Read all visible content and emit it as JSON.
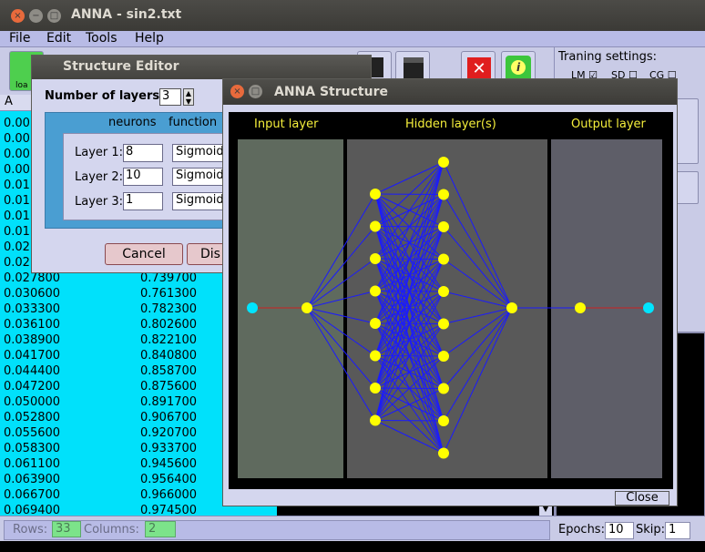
{
  "main": {
    "title": "ANNA - sin2.txt",
    "menu": [
      "File",
      "Edit",
      "Tools",
      "Help"
    ],
    "toolbar": {
      "load_label": "loa"
    },
    "grid": {
      "header": "A",
      "rows_a": [
        "0.00",
        "0.00",
        "0.00",
        "0.00",
        "0.01",
        "0.01",
        "0.01",
        "0.01",
        "0.02",
        "0.02",
        "0.027800",
        "0.030600",
        "0.033300",
        "0.036100",
        "0.038900",
        "0.041700",
        "0.044400",
        "0.047200",
        "0.050000",
        "0.052800",
        "0.055600",
        "0.058300",
        "0.061100",
        "0.063900",
        "0.066700",
        "0.069400"
      ],
      "rows_b": [
        "0.739700",
        "0.761300",
        "0.782300",
        "0.802600",
        "0.822100",
        "0.840800",
        "0.858700",
        "0.875600",
        "0.891700",
        "0.906700",
        "0.920700",
        "0.933700",
        "0.945600",
        "0.956400",
        "0.966000",
        "0.974500"
      ]
    },
    "settings": {
      "title": "Traning settings:",
      "opts": [
        "LM",
        "SD",
        "CG"
      ]
    },
    "status": {
      "rows_label": "Rows:",
      "rows_value": "33",
      "columns_label": "Columns:",
      "columns_value": "2",
      "epochs_label": "Epochs:",
      "epochs_value": "10",
      "skip_label": "Skip:",
      "skip_value": "1"
    }
  },
  "editor": {
    "title": "Structure Editor",
    "num_layers_label": "Number of layers:",
    "num_layers_value": "3",
    "col_neurons": "neurons",
    "col_function": "function",
    "layers": [
      {
        "label": "Layer 1:",
        "neurons": "8",
        "function": "Sigmoid"
      },
      {
        "label": "Layer 2:",
        "neurons": "10",
        "function": "Sigmoid"
      },
      {
        "label": "Layer 3:",
        "neurons": "1",
        "function": "Sigmoid"
      }
    ],
    "cancel_label": "Cancel",
    "discard_label": "Dis"
  },
  "anna": {
    "title": "ANNA Structure",
    "input_header": "Input layer",
    "hidden_header": "Hidden layer(s)",
    "output_header": "Output layer",
    "close_label": "Close",
    "colors": {
      "input_bg": "#5f6a5e",
      "hidden_bg": "#595959",
      "output_bg": "#5e5e68",
      "node": "#ffff00",
      "io_node": "#00e5ff",
      "edge": "#1a1aff",
      "io_edge": "#cc2222"
    }
  }
}
